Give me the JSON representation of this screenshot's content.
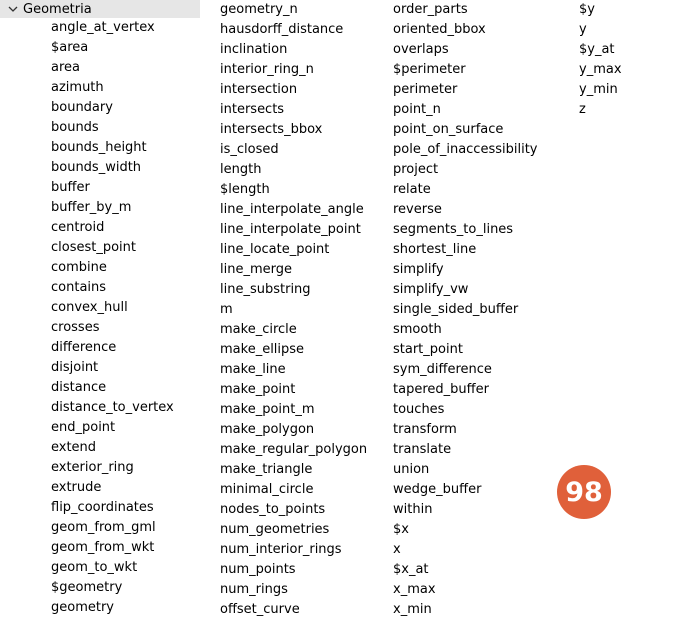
{
  "group": {
    "label": "Geometria",
    "expanded": true
  },
  "columns": [
    {
      "items": [
        "angle_at_vertex",
        "$area",
        "area",
        "azimuth",
        "boundary",
        "bounds",
        "bounds_height",
        "bounds_width",
        "buffer",
        "buffer_by_m",
        "centroid",
        "closest_point",
        "combine",
        "contains",
        "convex_hull",
        "crosses",
        "difference",
        "disjoint",
        "distance",
        "distance_to_vertex",
        "end_point",
        "extend",
        "exterior_ring",
        "extrude",
        "flip_coordinates",
        "geom_from_gml",
        "geom_from_wkt",
        "geom_to_wkt",
        "$geometry",
        "geometry"
      ]
    },
    {
      "items": [
        "geometry_n",
        "hausdorff_distance",
        "inclination",
        "interior_ring_n",
        "intersection",
        "intersects",
        "intersects_bbox",
        "is_closed",
        "length",
        "$length",
        "line_interpolate_angle",
        "line_interpolate_point",
        "line_locate_point",
        "line_merge",
        "line_substring",
        "m",
        "make_circle",
        "make_ellipse",
        "make_line",
        "make_point",
        "make_point_m",
        "make_polygon",
        "make_regular_polygon",
        "make_triangle",
        "minimal_circle",
        "nodes_to_points",
        "num_geometries",
        "num_interior_rings",
        "num_points",
        "num_rings",
        "offset_curve"
      ]
    },
    {
      "items": [
        "order_parts",
        "oriented_bbox",
        "overlaps",
        "$perimeter",
        "perimeter",
        "point_n",
        "point_on_surface",
        "pole_of_inaccessibility",
        "project",
        "relate",
        "reverse",
        "segments_to_lines",
        "shortest_line",
        "simplify",
        "simplify_vw",
        "single_sided_buffer",
        "smooth",
        "start_point",
        "sym_difference",
        "tapered_buffer",
        "touches",
        "transform",
        "translate",
        "union",
        "wedge_buffer",
        "within",
        "$x",
        "x",
        "$x_at",
        "x_max",
        "x_min"
      ]
    },
    {
      "items": [
        "$y",
        "y",
        "$y_at",
        "y_max",
        "y_min",
        "z"
      ]
    }
  ],
  "highlighted_item": "line_substring",
  "badge": {
    "number": "98",
    "color": "#e0603a"
  },
  "colors": {
    "highlight": "#ffff88",
    "header_background": "#e6e6e6"
  }
}
